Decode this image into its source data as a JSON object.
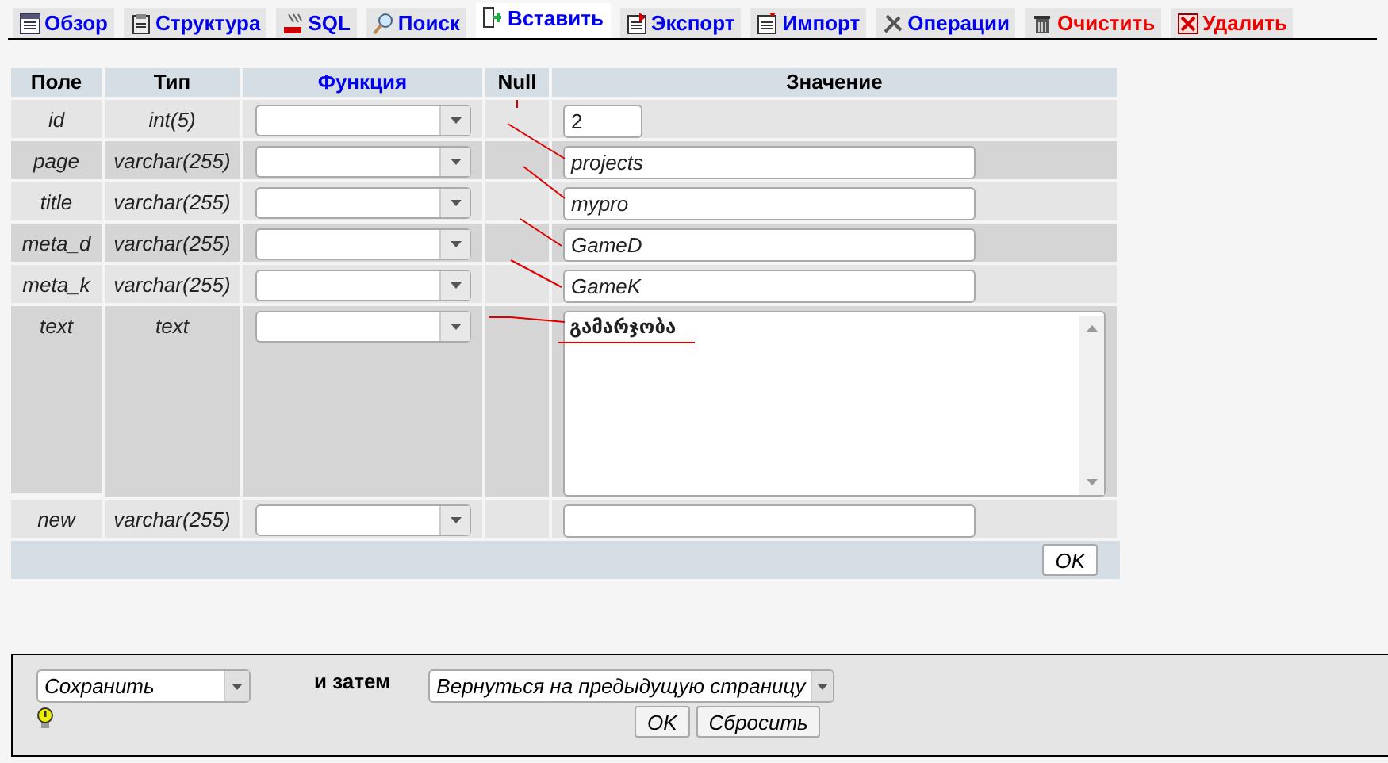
{
  "tabs": [
    {
      "label": "Обзор",
      "selected": false,
      "kind": "normal"
    },
    {
      "label": "Структура",
      "selected": false,
      "kind": "normal"
    },
    {
      "label": "SQL",
      "selected": false,
      "kind": "normal"
    },
    {
      "label": "Поиск",
      "selected": false,
      "kind": "normal"
    },
    {
      "label": "Вставить",
      "selected": true,
      "kind": "normal"
    },
    {
      "label": "Экспорт",
      "selected": false,
      "kind": "normal"
    },
    {
      "label": "Импорт",
      "selected": false,
      "kind": "normal"
    },
    {
      "label": "Операции",
      "selected": false,
      "kind": "normal"
    },
    {
      "label": "Очистить",
      "selected": false,
      "kind": "danger"
    },
    {
      "label": "Удалить",
      "selected": false,
      "kind": "danger"
    }
  ],
  "table": {
    "columns": [
      "Поле",
      "Тип",
      "Функция",
      "Null",
      "Значение"
    ],
    "rows": [
      {
        "field": "id",
        "type": "int(5)",
        "kind": "short_input",
        "value": "2"
      },
      {
        "field": "page",
        "type": "varchar(255)",
        "kind": "input",
        "value": "projects"
      },
      {
        "field": "title",
        "type": "varchar(255)",
        "kind": "input",
        "value": "mypro"
      },
      {
        "field": "meta_d",
        "type": "varchar(255)",
        "kind": "input",
        "value": "GameD"
      },
      {
        "field": "meta_k",
        "type": "varchar(255)",
        "kind": "input",
        "value": "GameK"
      },
      {
        "field": "text",
        "type": "text",
        "kind": "textarea",
        "value": "გამარჯობა"
      },
      {
        "field": "new",
        "type": "varchar(255)",
        "kind": "input"
      }
    ],
    "submit": "OK"
  },
  "after_insert": {
    "action": "Сохранить",
    "then_label": "и затем",
    "next": "Вернуться на предыдущую страницу",
    "buttons": [
      "OK",
      "Сбросить"
    ]
  }
}
